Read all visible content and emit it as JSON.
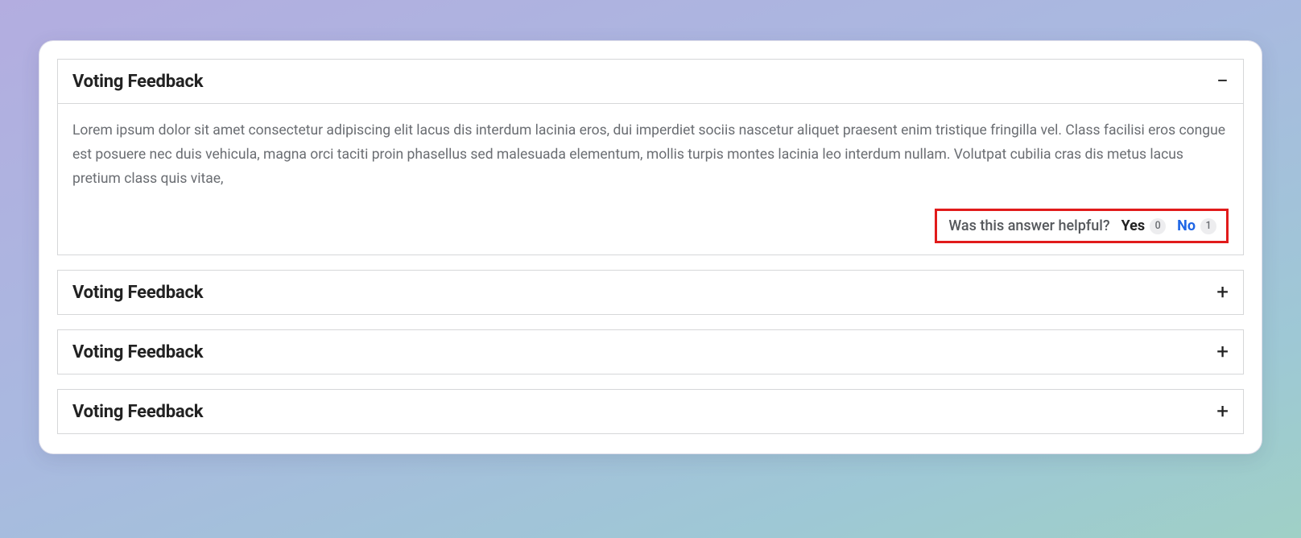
{
  "accordion": {
    "items": [
      {
        "title": "Voting Feedback",
        "expanded": true,
        "body": "Lorem ipsum dolor sit amet consectetur adipiscing elit lacus dis interdum lacinia eros, dui imperdiet sociis nascetur aliquet praesent enim tristique fringilla vel. Class facilisi eros congue est posuere nec duis vehicula, magna orci taciti proin phasellus sed malesuada elementum, mollis turpis montes lacinia leo interdum nullam. Volutpat cubilia cras dis metus lacus pretium class quis vitae,"
      },
      {
        "title": "Voting Feedback",
        "expanded": false
      },
      {
        "title": "Voting Feedback",
        "expanded": false
      },
      {
        "title": "Voting Feedback",
        "expanded": false
      }
    ]
  },
  "feedback": {
    "prompt": "Was this answer helpful?",
    "yes_label": "Yes",
    "yes_count": "0",
    "no_label": "No",
    "no_count": "1"
  },
  "glyphs": {
    "minus": "−",
    "plus": "+"
  },
  "highlight_color": "#e11b1b",
  "accent_color": "#1f66e5"
}
